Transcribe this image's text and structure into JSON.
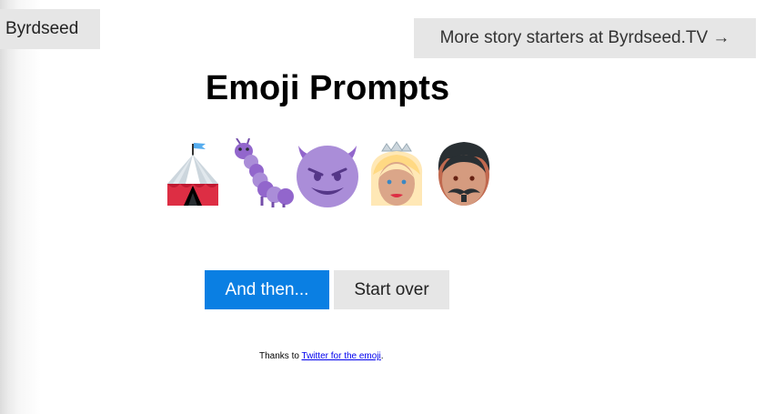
{
  "header": {
    "brand_label": "Byrdseed",
    "more_link_label": "More story starters at Byrdseed.TV →"
  },
  "main": {
    "title": "Emoji Prompts",
    "emojis": [
      {
        "name": "circus-tent-icon"
      },
      {
        "name": "caterpillar-icon"
      },
      {
        "name": "smiling-devil-icon"
      },
      {
        "name": "princess-icon"
      },
      {
        "name": "man-with-mustache-icon"
      }
    ],
    "and_then_label": "And then...",
    "start_over_label": "Start over"
  },
  "footer": {
    "thanks_prefix": "Thanks to ",
    "thanks_link": "Twitter for the emoji",
    "thanks_suffix": "."
  },
  "colors": {
    "primary_button": "#0a7fe3",
    "secondary_button": "#e6e6e6",
    "link": "#0000ee"
  }
}
